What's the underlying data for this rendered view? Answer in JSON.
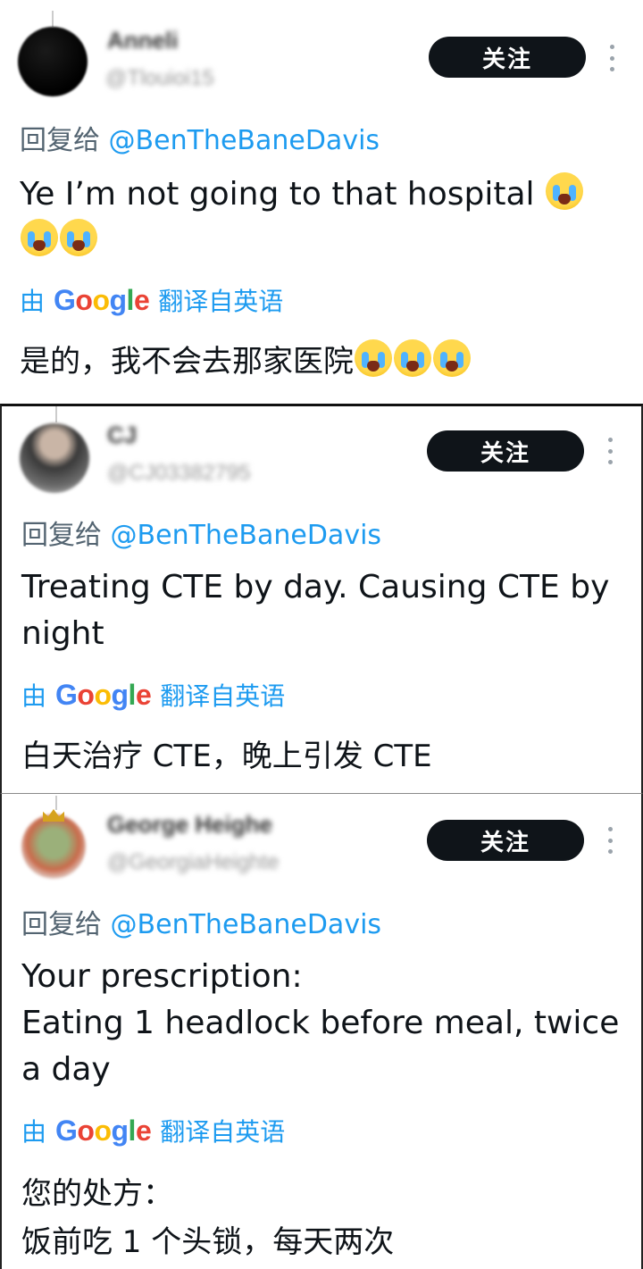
{
  "replies": [
    {
      "name_blurred": "Anneli",
      "handle_blurred": "@Tlouioi15",
      "follow_label": "关注",
      "reply_prefix": "回复给 ",
      "reply_to": "@BenTheBaneDavis",
      "text_line1": "Ye I’m not going to that hospital",
      "text_line2": "",
      "translate_by": "由",
      "translate_from": "翻译自英语",
      "translation": "是的，我不会去那家医院",
      "emoji": "loudly-crying-face-emoji"
    },
    {
      "name_blurred": "CJ",
      "handle_blurred": "@CJ03382795",
      "follow_label": "关注",
      "reply_prefix": "回复给 ",
      "reply_to": "@BenTheBaneDavis",
      "text_line1": "Treating CTE by day. Causing CTE by",
      "text_line2": "night",
      "translate_by": "由",
      "translate_from": "翻译自英语",
      "translation": "白天治疗 CTE，晚上引发 CTE"
    },
    {
      "name_blurred": "George Heighe",
      "handle_blurred": "@GeorgiaHeighte",
      "follow_label": "关注",
      "reply_prefix": "回复给 ",
      "reply_to": "@BenTheBaneDavis",
      "text_line1": "Your prescription:",
      "text_line2": "Eating 1 headlock before meal, twice",
      "text_line3": "a day",
      "translate_by": "由",
      "translate_from": "翻译自英语",
      "translation_line1": "您的处方：",
      "translation_line2": "饭前吃 1 个头锁，每天两次"
    }
  ],
  "google_logo": [
    "G",
    "o",
    "o",
    "g",
    "l",
    "e"
  ]
}
